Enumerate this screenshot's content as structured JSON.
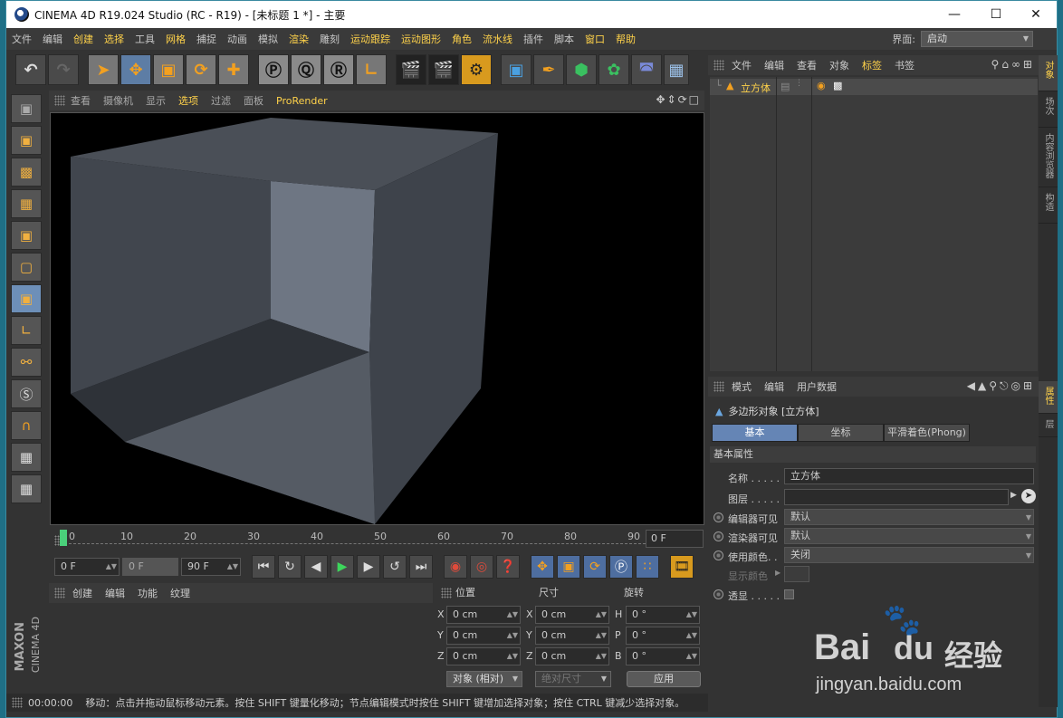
{
  "window": {
    "title": "CINEMA 4D R19.024 Studio (RC - R19) - [未标题 1 *] - 主要"
  },
  "menu": [
    "文件",
    "编辑",
    "创建",
    "选择",
    "工具",
    "网格",
    "捕捉",
    "动画",
    "模拟",
    "渲染",
    "雕刻",
    "运动跟踪",
    "运动图形",
    "角色",
    "流水线",
    "插件",
    "脚本",
    "窗口",
    "帮助"
  ],
  "layout": {
    "label": "界面:",
    "value": "启动"
  },
  "viewport": {
    "menu": [
      "查看",
      "摄像机",
      "显示",
      "选项",
      "过滤",
      "面板",
      "ProRender"
    ]
  },
  "timeline": {
    "ticks": [
      "0",
      "10",
      "20",
      "30",
      "40",
      "50",
      "60",
      "70",
      "80",
      "90"
    ],
    "current_frame": "0 F"
  },
  "transport": {
    "start": "0 F",
    "preview_start": "0 F",
    "end": "90 F"
  },
  "material_manager": {
    "menu": [
      "创建",
      "编辑",
      "功能",
      "纹理"
    ]
  },
  "coordinates": {
    "headers": [
      "位置",
      "尺寸",
      "旋转"
    ],
    "rows": [
      {
        "pos_axis": "X",
        "pos": "0 cm",
        "size_axis": "X",
        "size": "0 cm",
        "rot_axis": "H",
        "rot": "0 °"
      },
      {
        "pos_axis": "Y",
        "pos": "0 cm",
        "size_axis": "Y",
        "size": "0 cm",
        "rot_axis": "P",
        "rot": "0 °"
      },
      {
        "pos_axis": "Z",
        "pos": "0 cm",
        "size_axis": "Z",
        "size": "0 cm",
        "rot_axis": "B",
        "rot": "0 °"
      }
    ],
    "mode": "对象 (相对)",
    "size_mode": "绝对尺寸",
    "apply": "应用"
  },
  "status": {
    "time": "00:00:00",
    "message": "移动：点击并拖动鼠标移动元素。按住 SHIFT 键量化移动；节点编辑模式时按住 SHIFT 键增加选择对象；按住 CTRL 键减少选择对象。"
  },
  "object_manager": {
    "menu": [
      "文件",
      "编辑",
      "查看",
      "对象",
      "标签",
      "书签"
    ],
    "objects": [
      {
        "name": "立方体"
      }
    ]
  },
  "side_tabs": [
    "对象",
    "场次",
    "内容浏览器",
    "构造",
    "属性",
    "层"
  ],
  "attributes": {
    "menu": [
      "模式",
      "编辑",
      "用户数据"
    ],
    "object_title": "多边形对象 [立方体]",
    "tabs": [
      "基本",
      "坐标",
      "平滑着色(Phong)"
    ],
    "section": "基本属性",
    "fields": {
      "name_label": "名称 . . . . .",
      "name_value": "立方体",
      "layer_label": "图层 . . . . .",
      "editor_vis_label": "编辑器可见",
      "editor_vis_value": "默认",
      "render_vis_label": "渲染器可见",
      "render_vis_value": "默认",
      "use_color_label": "使用颜色. .",
      "use_color_value": "关闭",
      "display_color_label": "显示颜色",
      "xray_label": "透显 . . . . ."
    }
  },
  "watermark": {
    "brand": "Bai",
    "cn": "经验",
    "url": "jingyan.baidu.com"
  },
  "brand_vertical": [
    "MAXON",
    "CINEMA 4D"
  ]
}
